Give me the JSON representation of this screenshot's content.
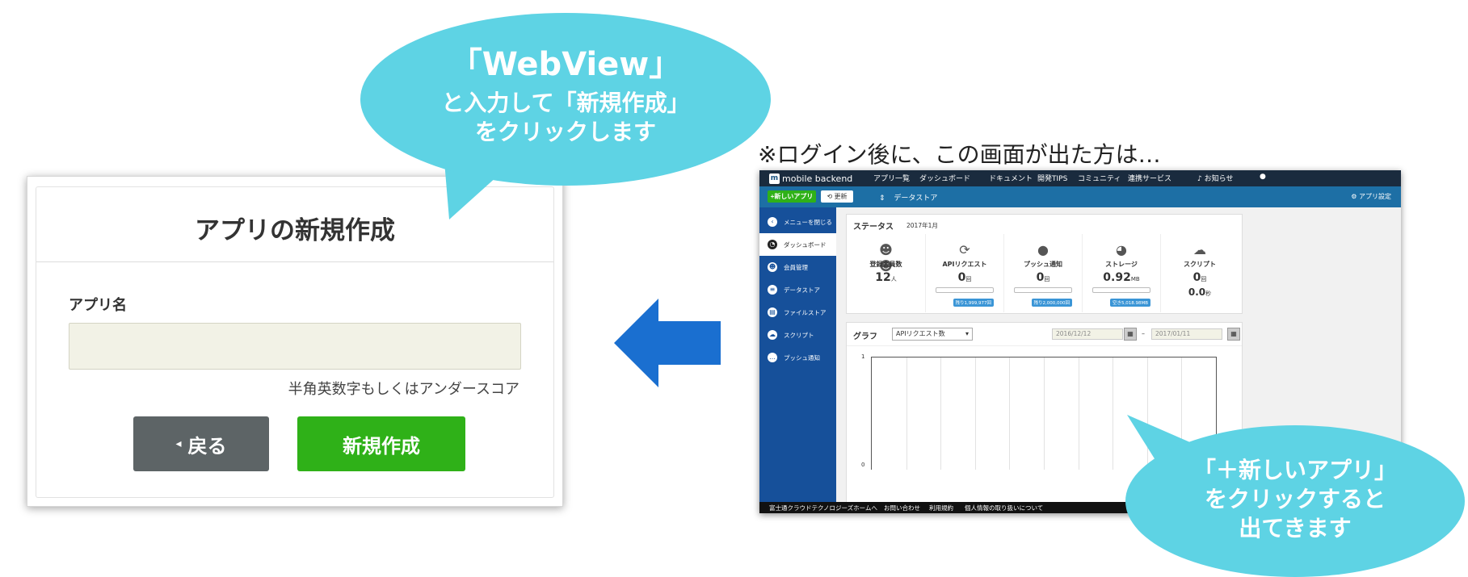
{
  "dialog": {
    "title": "アプリの新規作成",
    "field_label": "アプリ名",
    "field_value": "",
    "field_hint": "半角英数字もしくはアンダースコア",
    "back_label": "戻る",
    "create_label": "新規作成"
  },
  "bubble_top": {
    "line1": "「WebView」",
    "line2": "と入力して「新規作成」",
    "line3": "をクリックします"
  },
  "note": "※ログイン後に、この画面が出た方は…",
  "bubble_bottom": {
    "line1": "「＋新しいアプリ」",
    "line2": "をクリックすると",
    "line3": "出てきます"
  },
  "colors": {
    "bubble": "#5ed3e4",
    "arrow": "#1a6fd0",
    "create_button": "#2fb118",
    "back_button": "#5d6466"
  },
  "screenshot": {
    "brand": "mobile backend",
    "nav": [
      "アプリ一覧",
      "ダッシュボード",
      "ドキュメント",
      "開発TIPS",
      "コミュニティ",
      "連携サービス"
    ],
    "notifications": "お知らせ",
    "new_app_button": "+新しいアプリ",
    "refresh_button": "更新",
    "current_app": "データストア",
    "app_settings": "アプリ設定",
    "sidebar": [
      {
        "icon": "arrow-left-icon",
        "label": "メニューを閉じる"
      },
      {
        "icon": "dashboard-icon",
        "label": "ダッシュボード"
      },
      {
        "icon": "users-icon",
        "label": "会員管理"
      },
      {
        "icon": "list-icon",
        "label": "データストア"
      },
      {
        "icon": "file-icon",
        "label": "ファイルストア"
      },
      {
        "icon": "cloud-icon",
        "label": "スクリプト"
      },
      {
        "icon": "chat-icon",
        "label": "プッシュ通知"
      }
    ],
    "status": {
      "title": "ステータス",
      "period": "2017年1月",
      "stats": [
        {
          "icon": "users-icon",
          "label": "登録会員数",
          "value": "12",
          "unit": "人",
          "tag": ""
        },
        {
          "icon": "refresh-icon",
          "label": "APIリクエスト",
          "value": "0",
          "unit": "回",
          "tag": "残り1,999,977回"
        },
        {
          "icon": "chat-icon",
          "label": "プッシュ通知",
          "value": "0",
          "unit": "回",
          "tag": "残り2,000,000回"
        },
        {
          "icon": "pie-icon",
          "label": "ストレージ",
          "value": "0.92",
          "unit": "MB",
          "tag": "空き5,018.98MB"
        },
        {
          "icon": "cloud-gear-icon",
          "label": "スクリプト",
          "value": "0",
          "unit": "回",
          "value2": "0.0",
          "unit2": "秒",
          "tag": ""
        }
      ]
    },
    "graph": {
      "title": "グラフ",
      "select": "APIリクエスト数",
      "date_from": "2016/12/12",
      "date_sep": "–",
      "date_to": "2017/01/11",
      "y_top": "1",
      "y_bottom": "0"
    },
    "footer": [
      "富士通クラウドテクノロジーズホームへ",
      "お問い合わせ",
      "利用規約",
      "個人情報の取り扱いについて"
    ]
  }
}
